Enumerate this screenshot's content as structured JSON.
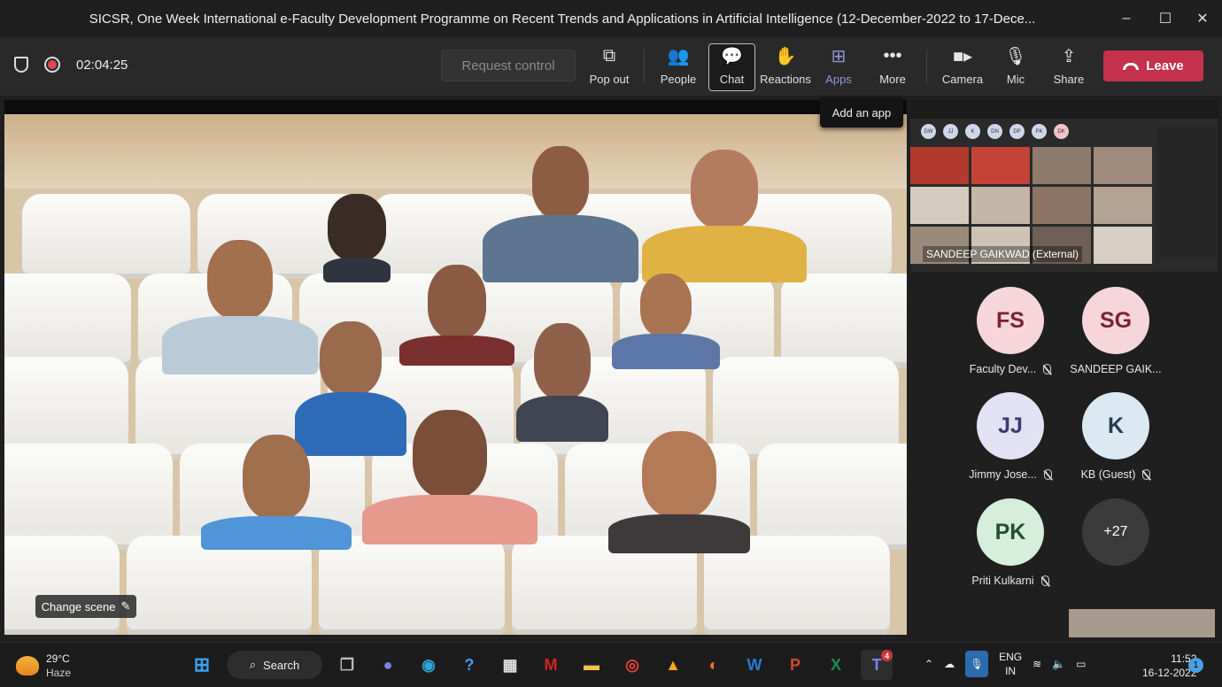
{
  "window": {
    "title": "SICSR, One Week International e-Faculty Development Programme on Recent Trends and Applications in Artificial Intelligence (12-December-2022 to 17-Dece...",
    "minimize": "–",
    "maximize": "☐",
    "close": "✕"
  },
  "toolbar": {
    "timer": "02:04:25",
    "request_control": "Request control",
    "buttons": [
      {
        "label": "Pop out",
        "icon": "popout-icon"
      },
      {
        "label": "People",
        "icon": "people-icon"
      },
      {
        "label": "Chat",
        "icon": "chat-icon"
      },
      {
        "label": "Reactions",
        "icon": "reactions-icon"
      },
      {
        "label": "Apps",
        "icon": "apps-icon"
      },
      {
        "label": "More",
        "icon": "more-icon"
      },
      {
        "label": "Camera",
        "icon": "camera-icon"
      },
      {
        "label": "Mic",
        "icon": "mic-icon"
      },
      {
        "label": "Share",
        "icon": "share-icon"
      }
    ],
    "leave": "Leave",
    "tooltip": "Add an app"
  },
  "stage": {
    "change_scene": "Change scene"
  },
  "shared_screen": {
    "caption": "SANDEEP GAIKWAD (External)",
    "mini_avatars": [
      "DW",
      "JJ",
      "K",
      "DN",
      "DP",
      "PK",
      "DK"
    ]
  },
  "participants": [
    {
      "initials": "FS",
      "name": "Faculty Dev...",
      "bg": "#f7d6db",
      "fg": "#7a2331"
    },
    {
      "initials": "SG",
      "name": "SANDEEP GAIK...",
      "bg": "#f7d6db",
      "fg": "#7a2331"
    },
    {
      "initials": "JJ",
      "name": "Jimmy Jose...",
      "bg": "#e3e2f5",
      "fg": "#3e3b73"
    },
    {
      "initials": "K",
      "name": "KB (Guest)",
      "bg": "#dbe9f3",
      "fg": "#243c52"
    },
    {
      "initials": "PK",
      "name": "Priti Kulkarni",
      "bg": "#d6eedc",
      "fg": "#1f5131"
    }
  ],
  "more_participants": "+27",
  "taskbar": {
    "temp": "29°C",
    "condition": "Haze",
    "search": "Search",
    "teams_badge": "4",
    "lang1": "ENG",
    "lang2": "IN",
    "time": "11:52",
    "date": "16-12-2022",
    "notifications": "1"
  },
  "colors": {
    "leave": "#c4314b",
    "apps": "#8f96d8",
    "accent": "#4a9fe6"
  }
}
